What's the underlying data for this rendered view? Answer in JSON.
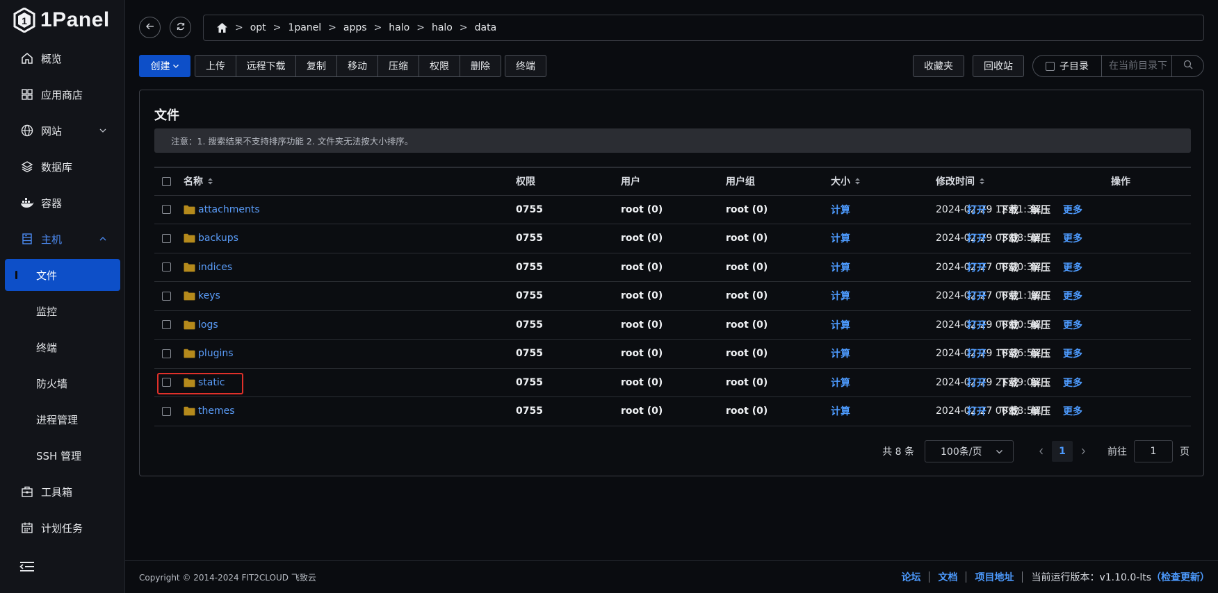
{
  "app": {
    "logo_text": "1Panel"
  },
  "sidebar": {
    "items": [
      {
        "label": "概览",
        "icon": "home-icon"
      },
      {
        "label": "应用商店",
        "icon": "grid-icon"
      },
      {
        "label": "网站",
        "icon": "globe-icon"
      },
      {
        "label": "数据库",
        "icon": "layers-icon"
      },
      {
        "label": "容器",
        "icon": "docker-icon"
      },
      {
        "label": "主机",
        "icon": "server-icon"
      }
    ],
    "host_sub": [
      "文件",
      "监控",
      "终端",
      "防火墙",
      "进程管理",
      "SSH 管理"
    ],
    "bottom_items": [
      {
        "label": "工具箱",
        "icon": "toolbox-icon"
      },
      {
        "label": "计划任务",
        "icon": "calendar-icon"
      }
    ]
  },
  "breadcrumb": [
    "opt",
    "1panel",
    "apps",
    "halo",
    "halo",
    "data"
  ],
  "toolbar": {
    "create": "创建",
    "actions": [
      "上传",
      "远程下载",
      "复制",
      "移动",
      "压缩",
      "权限",
      "删除"
    ],
    "terminal": "终端",
    "favorites": "收藏夹",
    "recycle": "回收站",
    "subdir_label": "子目录",
    "search_placeholder": "在当前目录下"
  },
  "card": {
    "title": "文件",
    "notice": "注意：1. 搜索结果不支持排序功能 2. 文件夹无法按大小排序。"
  },
  "table": {
    "headers": {
      "name": "名称",
      "perm": "权限",
      "user": "用户",
      "group": "用户组",
      "size": "大小",
      "mtime": "修改时间",
      "ops": "操作"
    },
    "rows": [
      {
        "name": "attachments",
        "perm": "0755",
        "user": "root (0)",
        "group": "root (0)",
        "size": "计算",
        "mtime": "2024-02-29 12:51:35"
      },
      {
        "name": "backups",
        "perm": "0755",
        "user": "root (0)",
        "group": "root (0)",
        "size": "计算",
        "mtime": "2024-02-29 03:08:52"
      },
      {
        "name": "indices",
        "perm": "0755",
        "user": "root (0)",
        "group": "root (0)",
        "size": "计算",
        "mtime": "2024-02-27 00:20:37"
      },
      {
        "name": "keys",
        "perm": "0755",
        "user": "root (0)",
        "group": "root (0)",
        "size": "计算",
        "mtime": "2024-02-27 00:21:11"
      },
      {
        "name": "logs",
        "perm": "0755",
        "user": "root (0)",
        "group": "root (0)",
        "size": "计算",
        "mtime": "2024-02-29 00:00:54"
      },
      {
        "name": "plugins",
        "perm": "0755",
        "user": "root (0)",
        "group": "root (0)",
        "size": "计算",
        "mtime": "2024-02-29 10:36:55"
      },
      {
        "name": "static",
        "perm": "0755",
        "user": "root (0)",
        "group": "root (0)",
        "size": "计算",
        "mtime": "2024-02-29 21:39:05"
      },
      {
        "name": "themes",
        "perm": "0755",
        "user": "root (0)",
        "group": "root (0)",
        "size": "计算",
        "mtime": "2024-02-27 00:58:58"
      }
    ],
    "row_ops": [
      "打开",
      "下载",
      "解压",
      "更多"
    ]
  },
  "pagination": {
    "total": "共 8 条",
    "page_size": "100条/页",
    "current_page": "1",
    "goto_label": "前往",
    "goto_value": "1",
    "page_suffix": "页"
  },
  "footer": {
    "copyright": "Copyright © 2014-2024 FIT2CLOUD 飞致云",
    "links": [
      "论坛",
      "文档",
      "项目地址"
    ],
    "version_label": "当前运行版本：v1.10.0-lts",
    "check_update": "（检查更新）"
  },
  "colors": {
    "accent": "#0d4fc8",
    "link": "#4d9bff",
    "highlight": "#e0302a",
    "folder": "#b58a1c"
  }
}
